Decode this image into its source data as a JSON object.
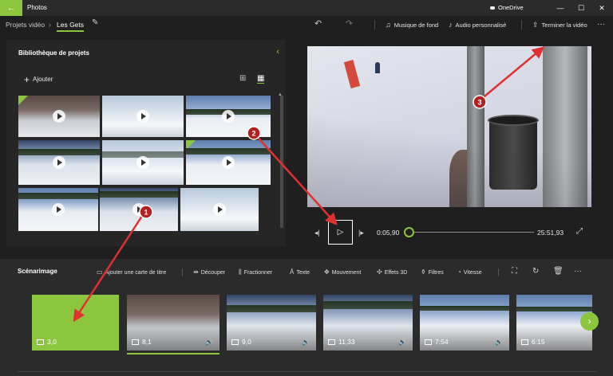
{
  "window": {
    "app_title": "Photos",
    "onedrive_label": "OneDrive",
    "minimize": "—",
    "maximize": "☐",
    "close": "✕"
  },
  "topbar": {
    "crumb_projects": "Projets vidéo",
    "crumb_current": "Les Gets",
    "undo": "↶",
    "redo": "↷",
    "music_label": "Musique de fond",
    "audio_label": "Audio personnalisé",
    "finish_label": "Terminer la vidéo",
    "more": "···"
  },
  "library": {
    "title": "Bibliothèque de projets",
    "add_label": "Ajouter",
    "icons": [
      "plus-icon",
      "grid-large-icon",
      "grid-small-icon",
      "chevron-left-icon"
    ]
  },
  "player": {
    "current_time": "0:05,90",
    "total_time": "25:51,93",
    "progress": 0.004
  },
  "storyboard": {
    "title": "Scénarimage",
    "tools": {
      "title_card": "Ajouter une carte de titre",
      "trim": "Découper",
      "split": "Fractionner",
      "text": "Texte",
      "motion": "Mouvement",
      "effects_3d": "Effets 3D",
      "filters": "Filtres",
      "speed": "Vitesse"
    },
    "clips": [
      {
        "duration": "3,0",
        "type": "title-card",
        "audio": false
      },
      {
        "duration": "8,1",
        "type": "video",
        "audio": true,
        "selected": true
      },
      {
        "duration": "9,0",
        "type": "video",
        "audio": true
      },
      {
        "duration": "11,33",
        "type": "video",
        "audio": true
      },
      {
        "duration": "7:54",
        "type": "video",
        "audio": true
      },
      {
        "duration": "6:15",
        "type": "video",
        "audio": false
      }
    ]
  },
  "annotations": [
    "1",
    "2",
    "3"
  ],
  "colors": {
    "accent": "#8cc63f",
    "arrow": "#e03030",
    "marker": "#b22020",
    "background": "#1f1f1f"
  }
}
